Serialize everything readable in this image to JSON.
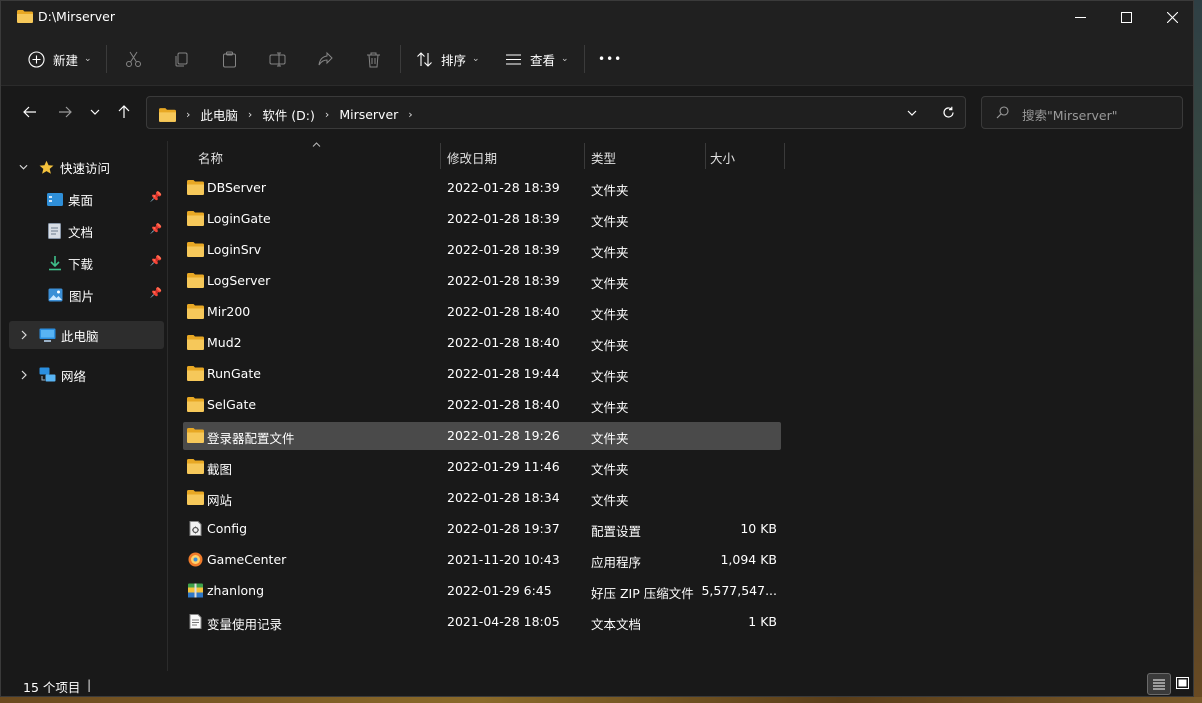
{
  "window": {
    "title": "D:\\Mirserver"
  },
  "caption": {
    "minimize": "—",
    "maximize": "☐",
    "close": "✕"
  },
  "commands": {
    "new_label": "新建",
    "sort_label": "排序",
    "view_label": "查看",
    "more_label": "•••"
  },
  "address": {
    "crumbs": [
      "此电脑",
      "软件 (D:)",
      "Mirserver"
    ],
    "search_placeholder": "搜索\"Mirserver\""
  },
  "sidebar": {
    "quick_access": "快速访问",
    "pinned": [
      {
        "label": "桌面",
        "icon": "desktop-icon"
      },
      {
        "label": "文档",
        "icon": "document-icon"
      },
      {
        "label": "下载",
        "icon": "download-icon"
      },
      {
        "label": "图片",
        "icon": "pictures-icon"
      }
    ],
    "this_pc": "此电脑",
    "network": "网络"
  },
  "columns": {
    "name": "名称",
    "modified": "修改日期",
    "type": "类型",
    "size": "大小"
  },
  "files": [
    {
      "name": "DBServer",
      "modified": "2022-01-28 18:39",
      "type": "文件夹",
      "size": "",
      "icon": "folder-icon"
    },
    {
      "name": "LoginGate",
      "modified": "2022-01-28 18:39",
      "type": "文件夹",
      "size": "",
      "icon": "folder-icon"
    },
    {
      "name": "LoginSrv",
      "modified": "2022-01-28 18:39",
      "type": "文件夹",
      "size": "",
      "icon": "folder-icon"
    },
    {
      "name": "LogServer",
      "modified": "2022-01-28 18:39",
      "type": "文件夹",
      "size": "",
      "icon": "folder-icon"
    },
    {
      "name": "Mir200",
      "modified": "2022-01-28 18:40",
      "type": "文件夹",
      "size": "",
      "icon": "folder-icon"
    },
    {
      "name": "Mud2",
      "modified": "2022-01-28 18:40",
      "type": "文件夹",
      "size": "",
      "icon": "folder-icon"
    },
    {
      "name": "RunGate",
      "modified": "2022-01-28 19:44",
      "type": "文件夹",
      "size": "",
      "icon": "folder-icon"
    },
    {
      "name": "SelGate",
      "modified": "2022-01-28 18:40",
      "type": "文件夹",
      "size": "",
      "icon": "folder-icon"
    },
    {
      "name": "登录器配置文件",
      "modified": "2022-01-28 19:26",
      "type": "文件夹",
      "size": "",
      "icon": "folder-icon",
      "selected": true
    },
    {
      "name": "截图",
      "modified": "2022-01-29 11:46",
      "type": "文件夹",
      "size": "",
      "icon": "folder-icon"
    },
    {
      "name": "网站",
      "modified": "2022-01-28 18:34",
      "type": "文件夹",
      "size": "",
      "icon": "folder-icon"
    },
    {
      "name": "Config",
      "modified": "2022-01-28 19:37",
      "type": "配置设置",
      "size": "10 KB",
      "icon": "config-file-icon"
    },
    {
      "name": "GameCenter",
      "modified": "2021-11-20 10:43",
      "type": "应用程序",
      "size": "1,094 KB",
      "icon": "application-icon"
    },
    {
      "name": "zhanlong",
      "modified": "2022-01-29 6:45",
      "type": "好压 ZIP 压缩文件",
      "size": "5,577,547...",
      "icon": "zip-archive-icon"
    },
    {
      "name": "变量使用记录",
      "modified": "2021-04-28 18:05",
      "type": "文本文档",
      "size": "1 KB",
      "icon": "text-file-icon"
    }
  ],
  "status": {
    "item_count": "15 个项目"
  },
  "colors": {
    "window_bg": "#191919",
    "chrome_bg": "#202020",
    "selected_row": "#4a4a4a",
    "folder": "#f2c14e"
  }
}
